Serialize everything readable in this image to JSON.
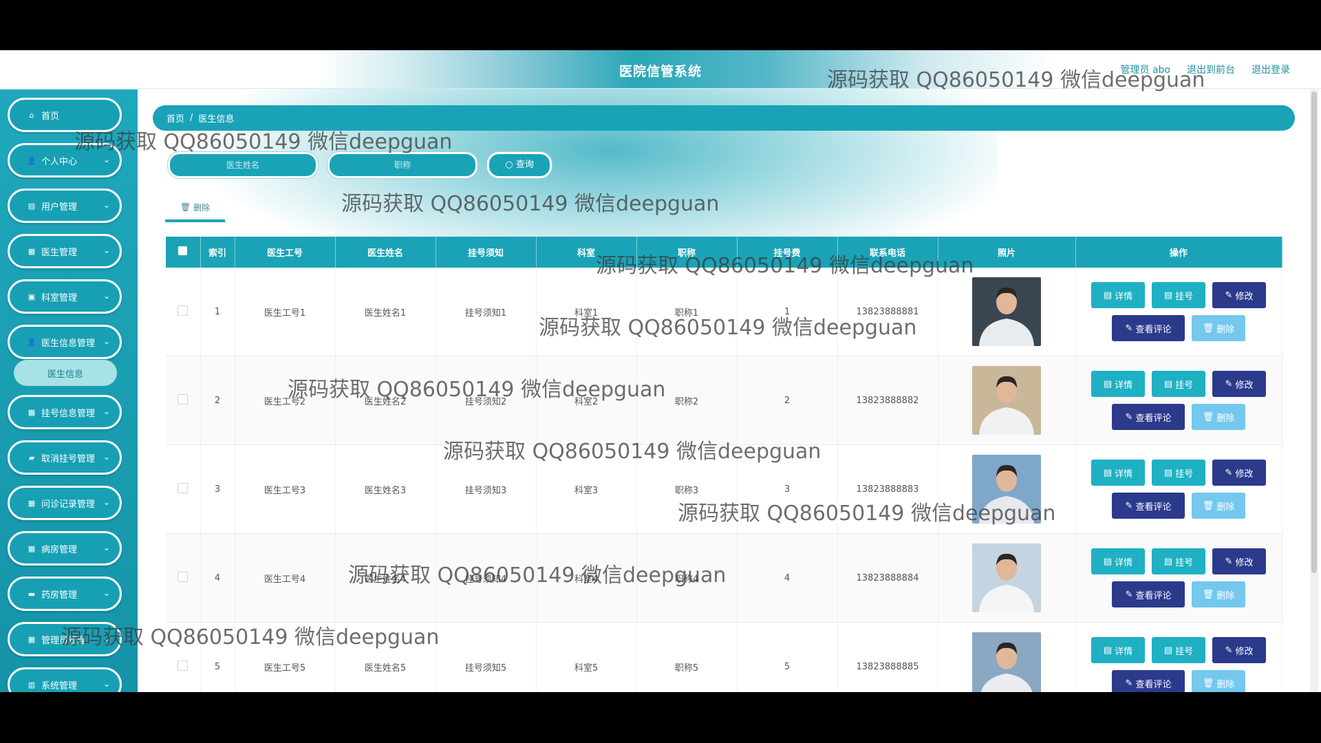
{
  "header": {
    "title": "医院信管系统",
    "links": [
      "管理员 abo",
      "退出到前台",
      "退出登录"
    ]
  },
  "sidebar": {
    "items": [
      {
        "label": "首页",
        "icon": "home-icon",
        "glyph": "⌂",
        "chev": ""
      },
      {
        "label": "个人中心",
        "icon": "user-icon",
        "glyph": "👤",
        "chev": "⌄"
      },
      {
        "label": "用户管理",
        "icon": "users-icon",
        "glyph": "▤",
        "chev": "⌄"
      },
      {
        "label": "医生管理",
        "icon": "grid-icon",
        "glyph": "▦",
        "chev": "⌄"
      },
      {
        "label": "科室管理",
        "icon": "clipboard-icon",
        "glyph": "▣",
        "chev": "⌄"
      },
      {
        "label": "医生信息管理",
        "icon": "user-icon",
        "glyph": "👤",
        "chev": "⌄"
      },
      {
        "label": "挂号信息管理",
        "icon": "grid-icon",
        "glyph": "▦",
        "chev": "⌄"
      },
      {
        "label": "取消挂号管理",
        "icon": "folder-icon",
        "glyph": "▰",
        "chev": "⌄"
      },
      {
        "label": "问诊记录管理",
        "icon": "grid-icon",
        "glyph": "▦",
        "chev": "⌄"
      },
      {
        "label": "病房管理",
        "icon": "grid-icon",
        "glyph": "▦",
        "chev": "⌄"
      },
      {
        "label": "药房管理",
        "icon": "ticket-icon",
        "glyph": "▬",
        "chev": "⌄"
      },
      {
        "label": "管理员管理",
        "icon": "grid-icon",
        "glyph": "▦",
        "chev": "⌄"
      },
      {
        "label": "系统管理",
        "icon": "chart-icon",
        "glyph": "▥",
        "chev": "⌄"
      }
    ],
    "active_sub": "医生信息"
  },
  "breadcrumb": {
    "home": "首页",
    "sep": "/",
    "current": "医生信息"
  },
  "search": {
    "name_placeholder": "医生姓名",
    "title_placeholder": "职称",
    "query_label": "查询"
  },
  "toolbar": {
    "delete_label": "删除"
  },
  "table": {
    "headers": [
      "索引",
      "医生工号",
      "医生姓名",
      "挂号须知",
      "科室",
      "职称",
      "挂号费",
      "联系电话",
      "照片",
      "操作"
    ],
    "rows": [
      {
        "index": "1",
        "id": "医生工号1",
        "name": "医生姓名1",
        "notice": "挂号须知1",
        "dept": "科室1",
        "title": "职称1",
        "fee": "1",
        "phone": "13823888881"
      },
      {
        "index": "2",
        "id": "医生工号2",
        "name": "医生姓名2",
        "notice": "挂号须知2",
        "dept": "科室2",
        "title": "职称2",
        "fee": "2",
        "phone": "13823888882"
      },
      {
        "index": "3",
        "id": "医生工号3",
        "name": "医生姓名3",
        "notice": "挂号须知3",
        "dept": "科室3",
        "title": "职称3",
        "fee": "3",
        "phone": "13823888883"
      },
      {
        "index": "4",
        "id": "医生工号4",
        "name": "医生姓名4",
        "notice": "挂号须知4",
        "dept": "科室4",
        "title": "职称4",
        "fee": "4",
        "phone": "13823888884"
      },
      {
        "index": "5",
        "id": "医生工号5",
        "name": "医生姓名5",
        "notice": "挂号须知5",
        "dept": "科室5",
        "title": "职称5",
        "fee": "5",
        "phone": "13823888885"
      }
    ],
    "actions": {
      "detail": "详情",
      "register": "挂号",
      "edit": "修改",
      "comments": "查看评论",
      "delete": "删除"
    }
  },
  "watermark": "源码获取 QQ86050149 微信deepguan",
  "colors": {
    "primary": "#1aa3b7",
    "dark_button": "#2c3a8c",
    "light_button": "#74c8ee"
  }
}
